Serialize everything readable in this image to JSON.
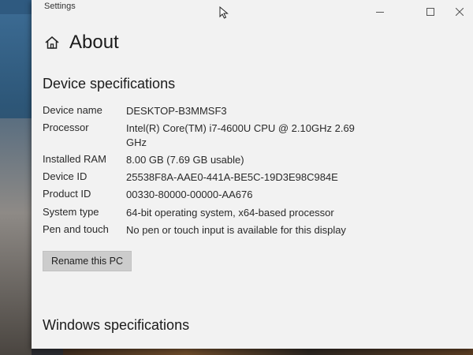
{
  "window": {
    "title": "Settings",
    "controls": {
      "minimize": "minimize-icon",
      "maximize": "maximize-icon",
      "close": "close-icon"
    }
  },
  "header": {
    "icon": "home-icon",
    "title": "About"
  },
  "device_specs": {
    "title": "Device specifications",
    "rows": [
      {
        "label": "Device name",
        "value": "DESKTOP-B3MMSF3"
      },
      {
        "label": "Processor",
        "value": "Intel(R) Core(TM) i7-4600U CPU @ 2.10GHz   2.69 GHz"
      },
      {
        "label": "Installed RAM",
        "value": "8.00 GB (7.69 GB usable)"
      },
      {
        "label": "Device ID",
        "value": "25538F8A-AAE0-441A-BE5C-19D3E98C984E"
      },
      {
        "label": "Product ID",
        "value": "00330-80000-00000-AA676"
      },
      {
        "label": "System type",
        "value": "64-bit operating system, x64-based processor"
      },
      {
        "label": "Pen and touch",
        "value": "No pen or touch input is available for this display"
      }
    ],
    "rename_button": "Rename this PC"
  },
  "windows_specs": {
    "title": "Windows specifications"
  },
  "colors": {
    "window_bg": "#f2f2f2",
    "button_bg": "#cccccc",
    "text": "#1b1b1b"
  }
}
